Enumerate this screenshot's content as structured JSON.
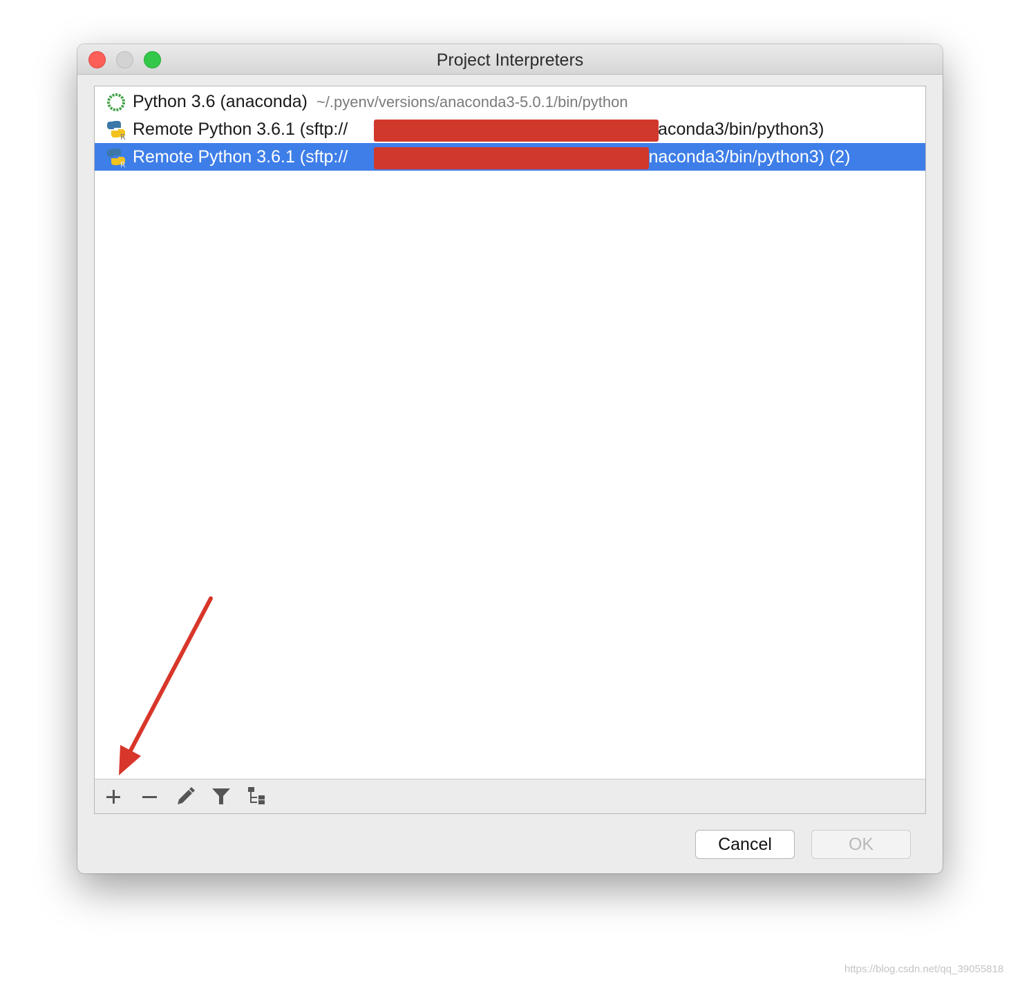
{
  "window": {
    "title": "Project Interpreters",
    "traffic_lights": [
      "close",
      "minimize",
      "zoom"
    ]
  },
  "interpreters": [
    {
      "icon": "anaconda-ring-icon",
      "name": "Python 3.6 (anaconda)",
      "path": "~/.pyenv/versions/anaconda3-5.0.1/bin/python",
      "selected": false
    },
    {
      "icon": "remote-python-icon",
      "name_prefix": "Remote Python 3.6.1 (sftp://",
      "name_suffix": "/anaconda3/bin/python3)",
      "redacted": true,
      "selected": false
    },
    {
      "icon": "remote-python-icon",
      "name_prefix": "Remote Python 3.6.1 (sftp://",
      "name_suffix": "c/anaconda3/bin/python3) (2)",
      "redacted": true,
      "selected": true
    }
  ],
  "toolbar": {
    "actions": [
      "add-icon",
      "remove-icon",
      "edit-pencil-icon",
      "filter-icon",
      "show-paths-tree-icon"
    ]
  },
  "buttons": {
    "cancel": "Cancel",
    "ok": "OK",
    "ok_enabled": false
  },
  "annotation": {
    "color": "#d8362a",
    "points_to": "add-icon"
  },
  "watermark": "https://blog.csdn.net/qq_39055818",
  "colors": {
    "selection": "#3e7ee8",
    "redaction": "#d1382c",
    "close": "#fc5f57",
    "zoom": "#34c84a"
  }
}
